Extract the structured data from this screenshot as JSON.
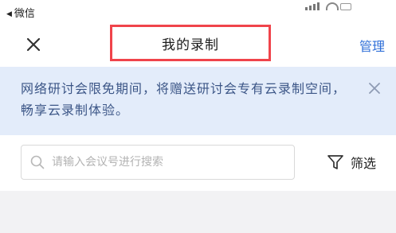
{
  "status_bar": {
    "back_indicator": "◀",
    "back_app": "微信"
  },
  "nav": {
    "title": "我的录制",
    "manage_label": "管理"
  },
  "banner": {
    "text": "网络研讨会限免期间，将赠送研讨会专有云录制空间，畅享云录制体验。"
  },
  "search": {
    "placeholder": "请输入会议号进行搜索",
    "value": ""
  },
  "filter": {
    "label": "筛选"
  },
  "colors": {
    "accent": "#2f6fd8",
    "highlight_border": "#f0444b",
    "banner_bg": "#e3ecfa",
    "banner_text": "#3c5687"
  }
}
